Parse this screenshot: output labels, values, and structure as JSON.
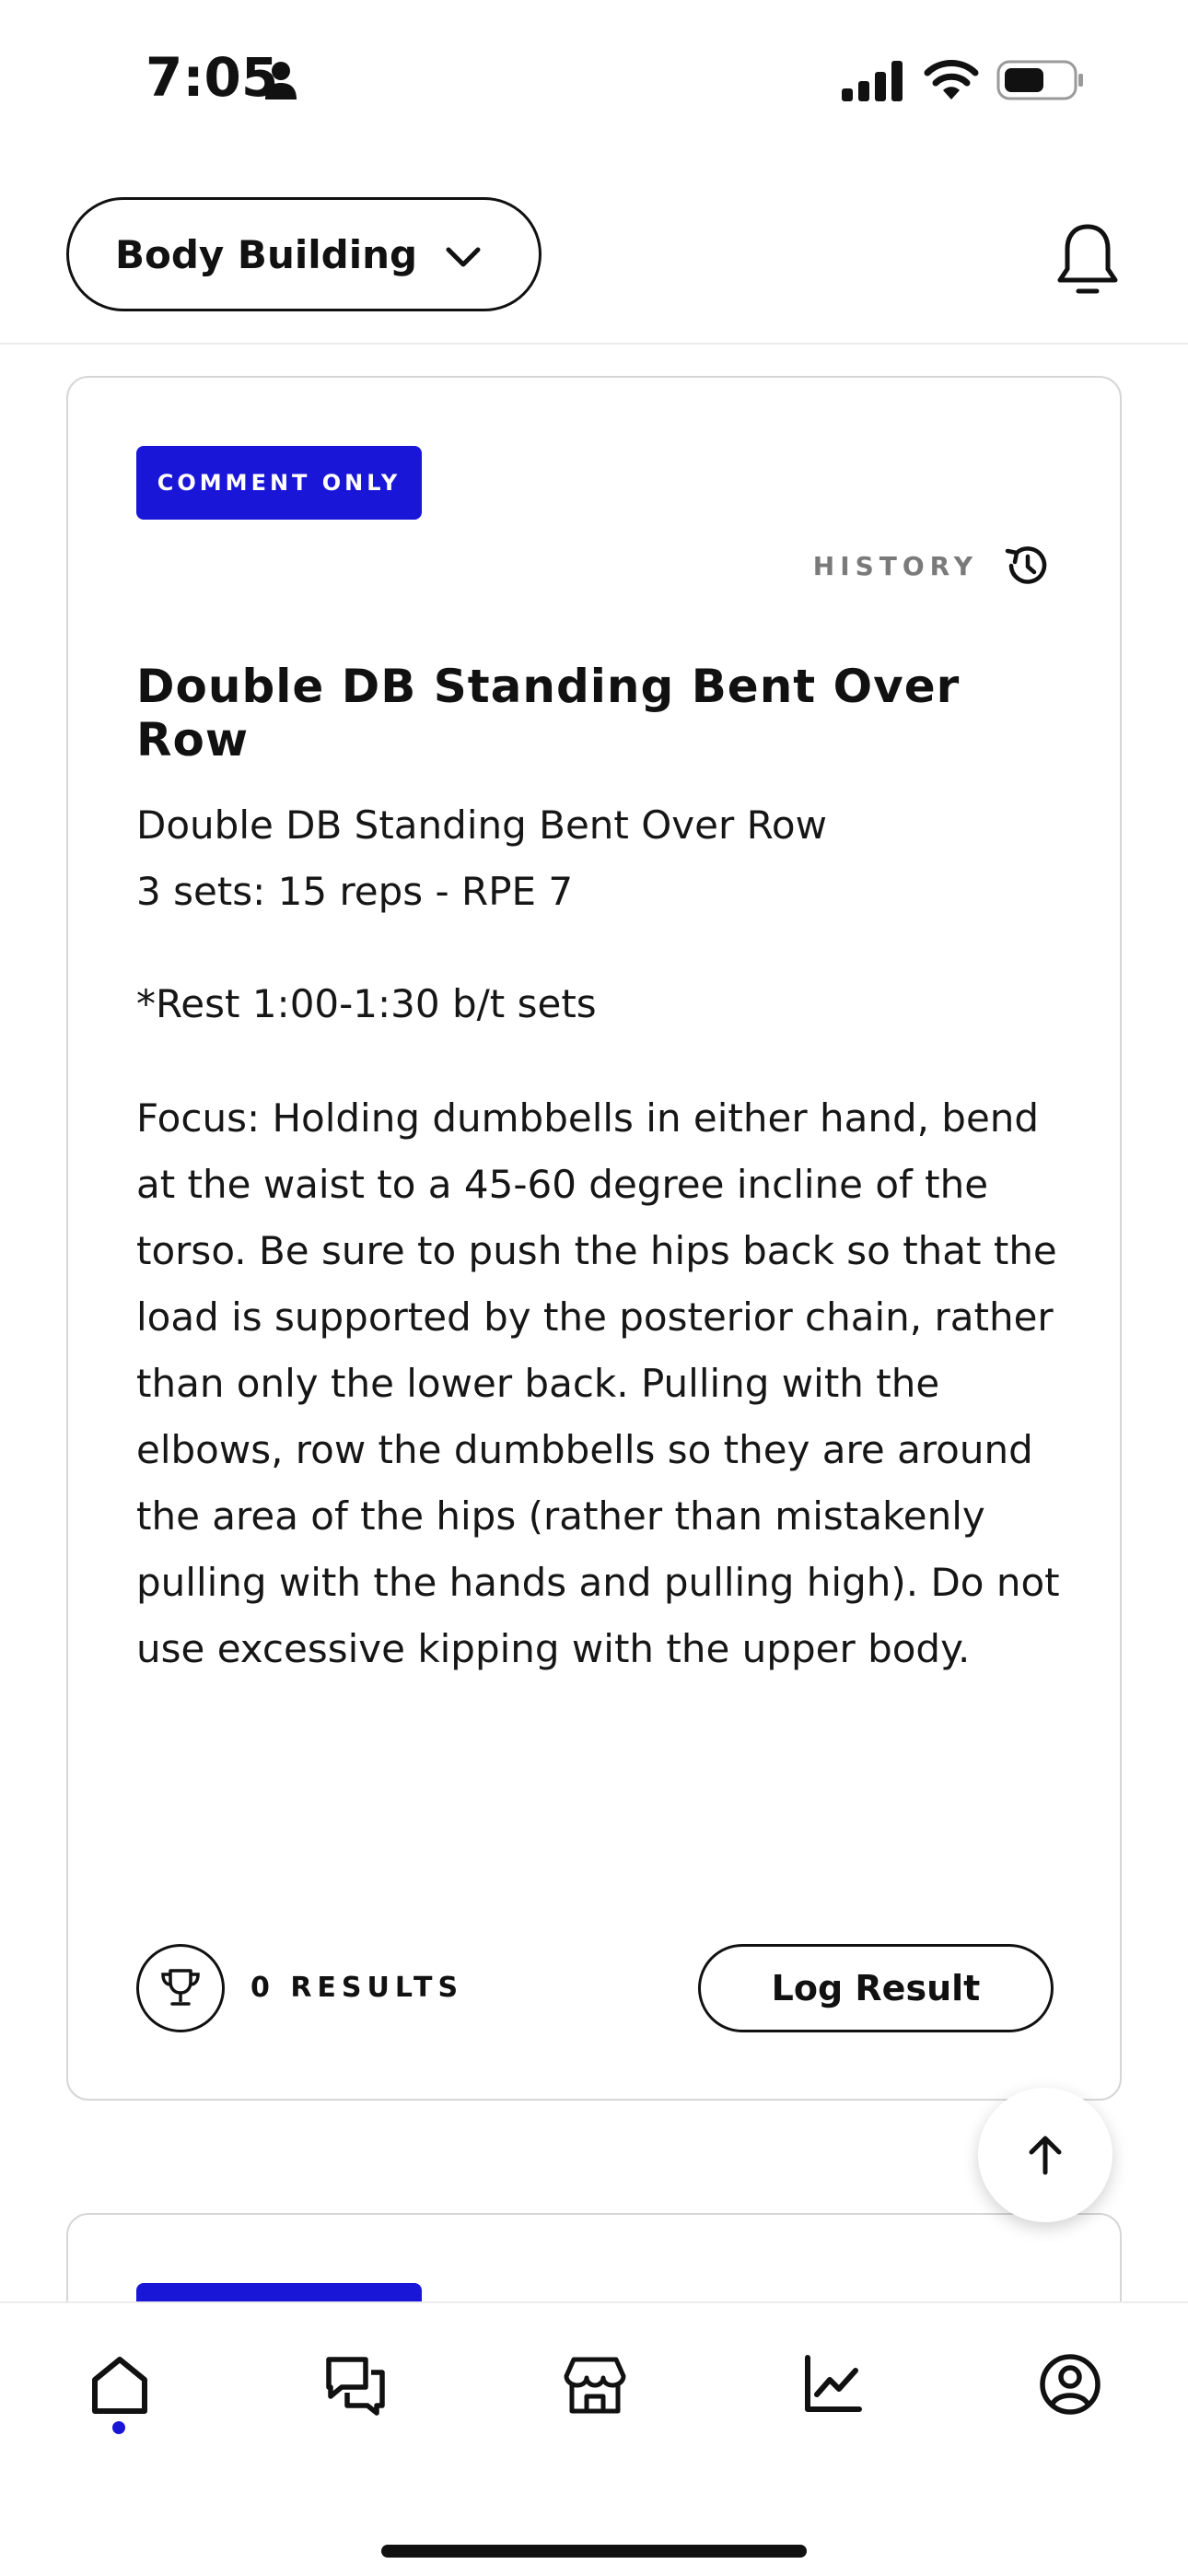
{
  "status_bar": {
    "time": "7:05"
  },
  "header": {
    "program_name": "Body Building"
  },
  "card": {
    "badge": "COMMENT ONLY",
    "history_label": "HISTORY",
    "title": "Double DB Standing Bent Over Row",
    "description_1": "Double DB Standing Bent Over Row\n3 sets: 15 reps - RPE 7",
    "description_2": "*Rest 1:00-1:30 b/t sets",
    "description_3": "Focus: Holding dumbbells in either hand, bend at the waist to a 45-60 degree incline of the torso. Be sure to push the hips back so that the load is supported by the posterior chain, rather than only the lower back. Pulling with the elbows, row the dumbbells so they are around the area of the hips (rather than mistakenly pulling with the hands and pulling high). Do not use excessive kipping with the upper body.",
    "results_text": "0 RESULTS",
    "log_button": "Log Result"
  },
  "colors": {
    "accent": "#1a16d8",
    "text": "#111111",
    "muted": "#7a7a7a"
  },
  "icons": [
    "person-icon",
    "signal-icon",
    "wifi-icon",
    "battery-icon",
    "chevron-down-icon",
    "bell-icon",
    "history-icon",
    "trophy-icon",
    "arrow-up-icon",
    "home-icon",
    "chat-icon",
    "store-icon",
    "chart-icon",
    "profile-icon"
  ],
  "nav": {
    "active": "home"
  }
}
